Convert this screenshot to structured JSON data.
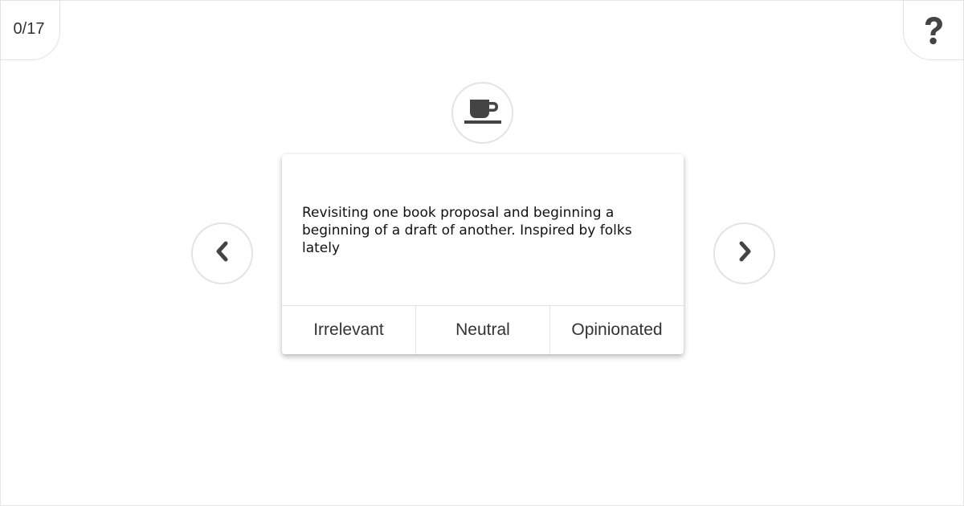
{
  "progress": {
    "counter_text": "0/17"
  },
  "header": {
    "help_icon": "question-mark-icon"
  },
  "topic": {
    "icon": "coffee-cup-icon"
  },
  "card": {
    "text": "Revisiting one book proposal and beginning a beginning of a draft of another. Inspired by folks lately",
    "actions": [
      {
        "label": "Irrelevant"
      },
      {
        "label": "Neutral"
      },
      {
        "label": "Opinionated"
      }
    ]
  },
  "navigation": {
    "prev_icon": "chevron-left-icon",
    "next_icon": "chevron-right-icon"
  },
  "colors": {
    "icon": "#444444",
    "border": "#e3e3e3",
    "text": "#333333"
  }
}
